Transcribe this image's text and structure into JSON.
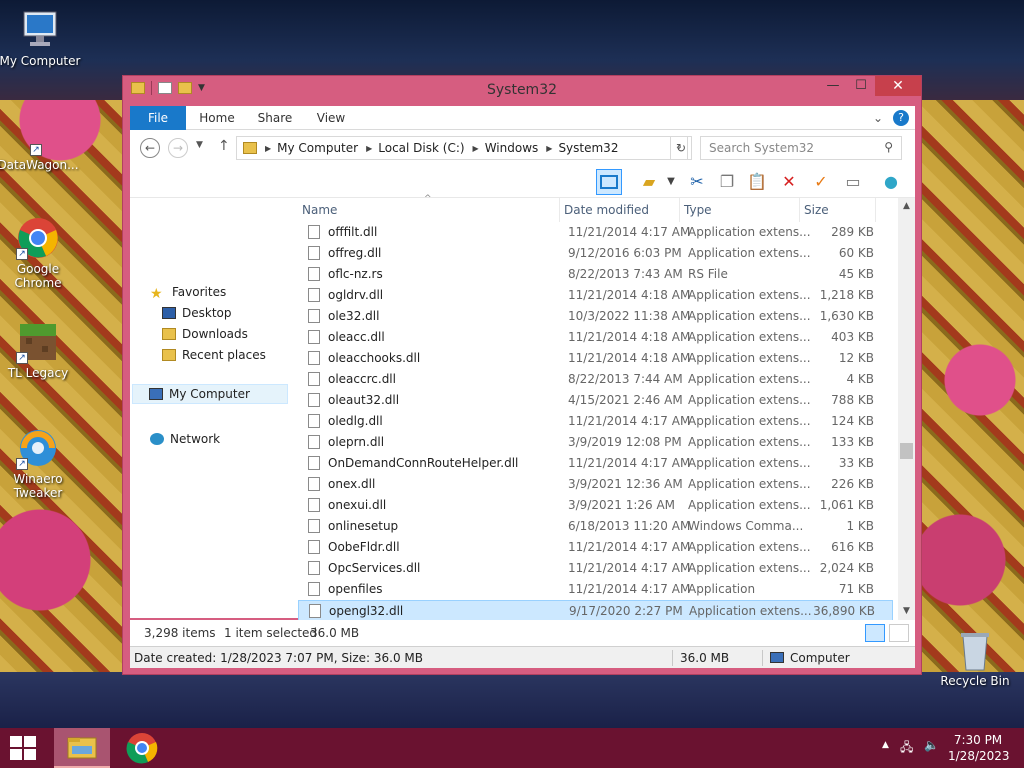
{
  "desktop": {
    "icons": [
      {
        "label": "My Computer"
      },
      {
        "label": "DataWagon..."
      },
      {
        "label": "Google Chrome"
      },
      {
        "label": "TL Legacy"
      },
      {
        "label": "Winaero Tweaker"
      },
      {
        "label": "Recycle Bin"
      }
    ]
  },
  "window": {
    "title": "System32",
    "controls": {
      "minimize": "—",
      "maximize": "☐",
      "close": "✕"
    },
    "ribbon_tabs": [
      "File",
      "Home",
      "Share",
      "View"
    ],
    "breadcrumb": [
      "My Computer",
      "Local Disk (C:)",
      "Windows",
      "System32"
    ],
    "search_placeholder": "Search System32",
    "nav_pane": {
      "favorites": "Favorites",
      "favorite_items": [
        "Desktop",
        "Downloads",
        "Recent places"
      ],
      "my_computer": "My Computer",
      "network": "Network"
    },
    "columns": {
      "name": "Name",
      "date": "Date modified",
      "type": "Type",
      "size": "Size"
    },
    "files": [
      {
        "name": "offfilt.dll",
        "date": "11/21/2014 4:17 AM",
        "type": "Application extens...",
        "size": "289 KB"
      },
      {
        "name": "offreg.dll",
        "date": "9/12/2016 6:03 PM",
        "type": "Application extens...",
        "size": "60 KB"
      },
      {
        "name": "oflc-nz.rs",
        "date": "8/22/2013 7:43 AM",
        "type": "RS File",
        "size": "45 KB"
      },
      {
        "name": "ogldrv.dll",
        "date": "11/21/2014 4:18 AM",
        "type": "Application extens...",
        "size": "1,218 KB"
      },
      {
        "name": "ole32.dll",
        "date": "10/3/2022 11:38 AM",
        "type": "Application extens...",
        "size": "1,630 KB"
      },
      {
        "name": "oleacc.dll",
        "date": "11/21/2014 4:18 AM",
        "type": "Application extens...",
        "size": "403 KB"
      },
      {
        "name": "oleacchooks.dll",
        "date": "11/21/2014 4:18 AM",
        "type": "Application extens...",
        "size": "12 KB"
      },
      {
        "name": "oleaccrc.dll",
        "date": "8/22/2013 7:44 AM",
        "type": "Application extens...",
        "size": "4 KB"
      },
      {
        "name": "oleaut32.dll",
        "date": "4/15/2021 2:46 AM",
        "type": "Application extens...",
        "size": "788 KB"
      },
      {
        "name": "oledlg.dll",
        "date": "11/21/2014 4:17 AM",
        "type": "Application extens...",
        "size": "124 KB"
      },
      {
        "name": "oleprn.dll",
        "date": "3/9/2019 12:08 PM",
        "type": "Application extens...",
        "size": "133 KB"
      },
      {
        "name": "OnDemandConnRouteHelper.dll",
        "date": "11/21/2014 4:17 AM",
        "type": "Application extens...",
        "size": "33 KB"
      },
      {
        "name": "onex.dll",
        "date": "3/9/2021 12:36 AM",
        "type": "Application extens...",
        "size": "226 KB"
      },
      {
        "name": "onexui.dll",
        "date": "3/9/2021 1:26 AM",
        "type": "Application extens...",
        "size": "1,061 KB"
      },
      {
        "name": "onlinesetup",
        "date": "6/18/2013 11:20 AM",
        "type": "Windows Comma...",
        "size": "1 KB"
      },
      {
        "name": "OobeFldr.dll",
        "date": "11/21/2014 4:17 AM",
        "type": "Application extens...",
        "size": "616 KB"
      },
      {
        "name": "OpcServices.dll",
        "date": "11/21/2014 4:17 AM",
        "type": "Application extens...",
        "size": "2,024 KB"
      },
      {
        "name": "openfiles",
        "date": "11/21/2014 4:17 AM",
        "type": "Application",
        "size": "71 KB"
      },
      {
        "name": "opengl32.dll",
        "date": "9/17/2020 2:27 PM",
        "type": "Application extens...",
        "size": "36,890 KB",
        "selected": true
      }
    ],
    "status": {
      "items_count": "3,298 items",
      "selected": "1 item selected",
      "selected_size": "36.0 MB",
      "details": "Date created: 1/28/2023 7:07 PM, Size: 36.0 MB",
      "size2": "36.0 MB",
      "location": "Computer"
    }
  },
  "taskbar": {
    "time": "7:30 PM",
    "date": "1/28/2023"
  },
  "colors": {
    "window_frame": "#d65d80",
    "file_tab": "#1979ca",
    "selection": "#cce8ff",
    "taskbar": "#6a1230"
  }
}
